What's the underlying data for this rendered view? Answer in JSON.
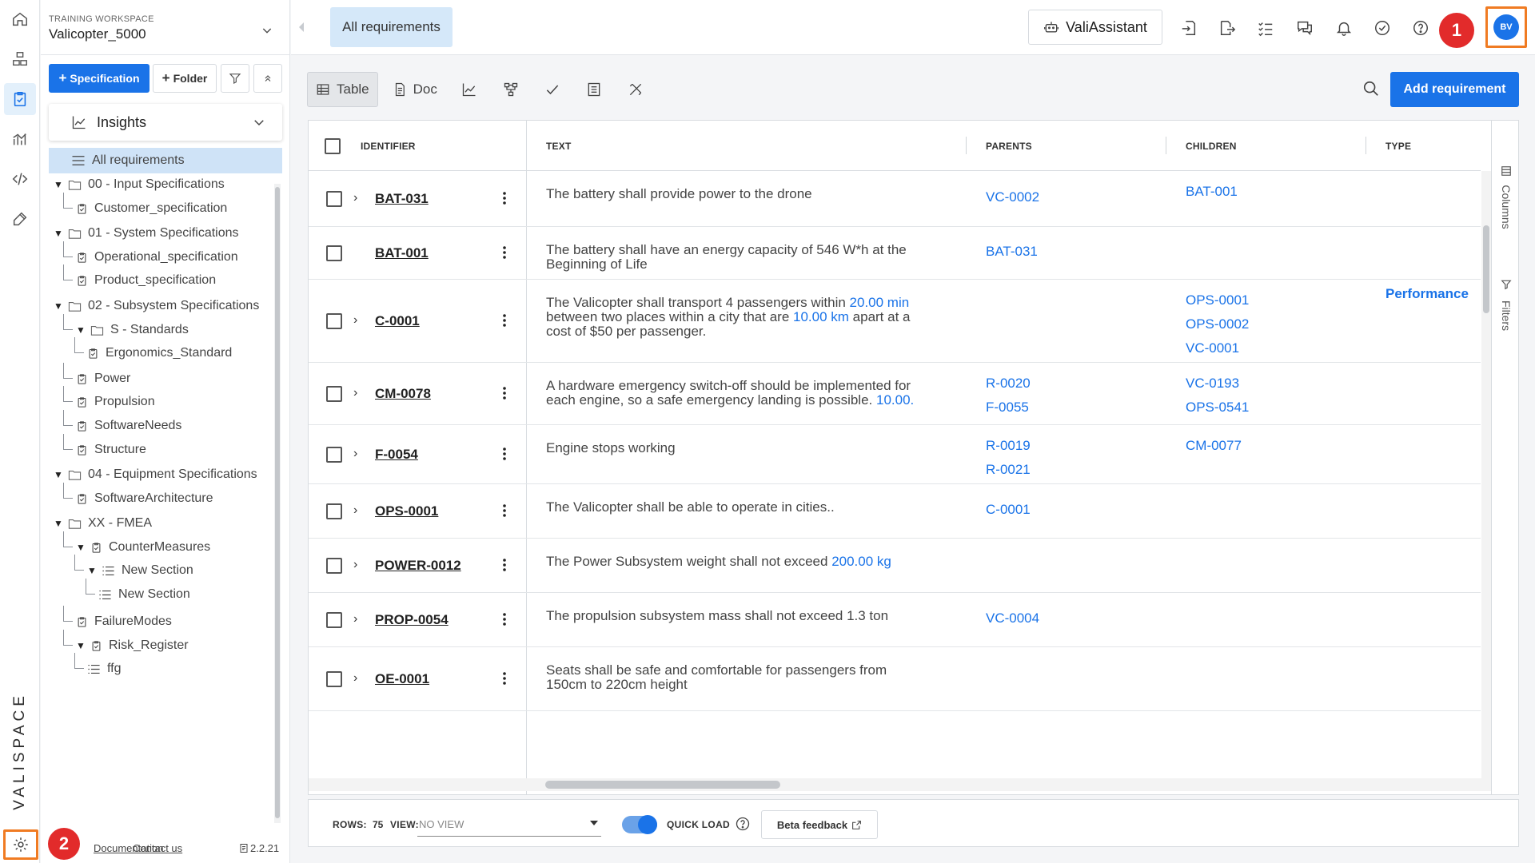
{
  "brand": {
    "logo_text": "VALISPACE",
    "accent": "#1a73e8",
    "highlight": "#f07b22",
    "badge": "#e22b2b"
  },
  "workspace": {
    "label": "TRAINING WORKSPACE",
    "name": "Valicopter_5000"
  },
  "panel": {
    "spec_button": "Specification",
    "folder_button": "Folder",
    "insights": "Insights",
    "footer": {
      "documentation": "Documentation",
      "contact": "Contact us",
      "version": "2.2.21"
    }
  },
  "tree": [
    {
      "label": "All requirements",
      "icon": "list-icon",
      "selected": true
    },
    {
      "label": "00 - Input Specifications",
      "icon": "folder-icon",
      "expanded": true
    },
    {
      "label": "Customer_specification",
      "icon": "spec-icon"
    },
    {
      "label": "01 - System Specifications",
      "icon": "folder-icon",
      "expanded": true
    },
    {
      "label": "Operational_specification",
      "icon": "spec-icon"
    },
    {
      "label": "Product_specification",
      "icon": "spec-icon"
    },
    {
      "label": "02 - Subsystem Specifications",
      "icon": "folder-icon",
      "expanded": true
    },
    {
      "label": "S - Standards",
      "icon": "folder-icon",
      "expanded": true
    },
    {
      "label": "Ergonomics_Standard",
      "icon": "spec-icon"
    },
    {
      "label": "Power",
      "icon": "spec-icon"
    },
    {
      "label": "Propulsion",
      "icon": "spec-icon"
    },
    {
      "label": "SoftwareNeeds",
      "icon": "spec-icon"
    },
    {
      "label": "Structure",
      "icon": "spec-icon"
    },
    {
      "label": "04 - Equipment Specifications",
      "icon": "folder-icon",
      "expanded": true
    },
    {
      "label": "SoftwareArchitecture",
      "icon": "spec-icon"
    },
    {
      "label": "XX - FMEA",
      "icon": "folder-icon",
      "expanded": true
    },
    {
      "label": "CounterMeasures",
      "icon": "spec-icon",
      "expanded": true
    },
    {
      "label": "New Section",
      "icon": "section-icon",
      "expanded": true
    },
    {
      "label": "New Section",
      "icon": "section-icon"
    },
    {
      "label": "FailureModes",
      "icon": "spec-icon"
    },
    {
      "label": "Risk_Register",
      "icon": "spec-icon",
      "expanded": true
    },
    {
      "label": "ffg",
      "icon": "section-icon"
    }
  ],
  "topbar": {
    "active_tab": "All requirements",
    "assistant": "ValiAssistant",
    "avatar": "BV"
  },
  "badges": {
    "one": "1",
    "two": "2"
  },
  "toolbar": {
    "table": "Table",
    "doc": "Doc",
    "add_requirement": "Add requirement"
  },
  "grid": {
    "columns": {
      "identifier": "IDENTIFIER",
      "text": "TEXT",
      "parents": "PARENTS",
      "children": "CHILDREN",
      "type": "TYPE"
    },
    "side_labels": {
      "columns": "Columns",
      "filters": "Filters"
    },
    "rows": [
      {
        "id": "BAT-031",
        "expandable": true,
        "text": [
          {
            "t": "The battery shall provide power to the drone"
          }
        ],
        "parents": [
          "VC-0002"
        ],
        "children": [
          "BAT-001"
        ],
        "type": ""
      },
      {
        "id": "BAT-001",
        "expandable": false,
        "text": [
          {
            "t": "The battery shall have an energy capacity of 546 W*h at the Beginning of Life"
          }
        ],
        "parents": [
          "BAT-031"
        ],
        "children": [],
        "type": ""
      },
      {
        "id": "C-0001",
        "expandable": true,
        "text": [
          {
            "t": "The Valicopter shall transport 4 passengers within "
          },
          {
            "t": "20.00  min",
            "n": true
          },
          {
            "t": " between two places within a city that are "
          },
          {
            "t": "10.00  km",
            "n": true
          },
          {
            "t": " apart at a cost of $50 per passenger."
          }
        ],
        "parents": [],
        "children": [
          "OPS-0001",
          "OPS-0002",
          "VC-0001"
        ],
        "type": "Performance"
      },
      {
        "id": "CM-0078",
        "expandable": true,
        "text": [
          {
            "t": "A hardware emergency switch-off should be implemented for each engine, so a safe emergency landing is possible. "
          },
          {
            "t": "10.00.",
            "n": true
          }
        ],
        "parents": [
          "R-0020",
          "F-0055"
        ],
        "children": [
          "VC-0193",
          "OPS-0541"
        ],
        "type": ""
      },
      {
        "id": "F-0054",
        "expandable": true,
        "text": [
          {
            "t": "Engine stops working"
          }
        ],
        "parents": [
          "R-0019",
          "R-0021"
        ],
        "children": [
          "CM-0077"
        ],
        "type": ""
      },
      {
        "id": "OPS-0001",
        "expandable": true,
        "text": [
          {
            "t": "The Valicopter shall be able to operate in cities.."
          }
        ],
        "parents": [
          "C-0001"
        ],
        "children": [],
        "type": ""
      },
      {
        "id": "POWER-0012",
        "expandable": true,
        "text": [
          {
            "t": "The Power Subsystem weight shall not exceed "
          },
          {
            "t": "200.00  kg",
            "n": true
          }
        ],
        "parents": [],
        "children": [],
        "type": ""
      },
      {
        "id": "PROP-0054",
        "expandable": true,
        "text": [
          {
            "t": "The propulsion subsystem mass shall not exceed 1.3 ton"
          }
        ],
        "parents": [
          "VC-0004"
        ],
        "children": [],
        "type": ""
      },
      {
        "id": "OE-0001",
        "expandable": true,
        "text": [
          {
            "t": "Seats shall be safe and comfortable for passengers from 150cm to 220cm height"
          }
        ],
        "parents": [],
        "children": [],
        "type": ""
      }
    ]
  },
  "footer": {
    "rows_label": "ROWS:",
    "rows_value": "75",
    "view_label": "VIEW:",
    "view_value": "NO VIEW",
    "quick_load": "QUICK LOAD",
    "beta": "Beta feedback"
  }
}
